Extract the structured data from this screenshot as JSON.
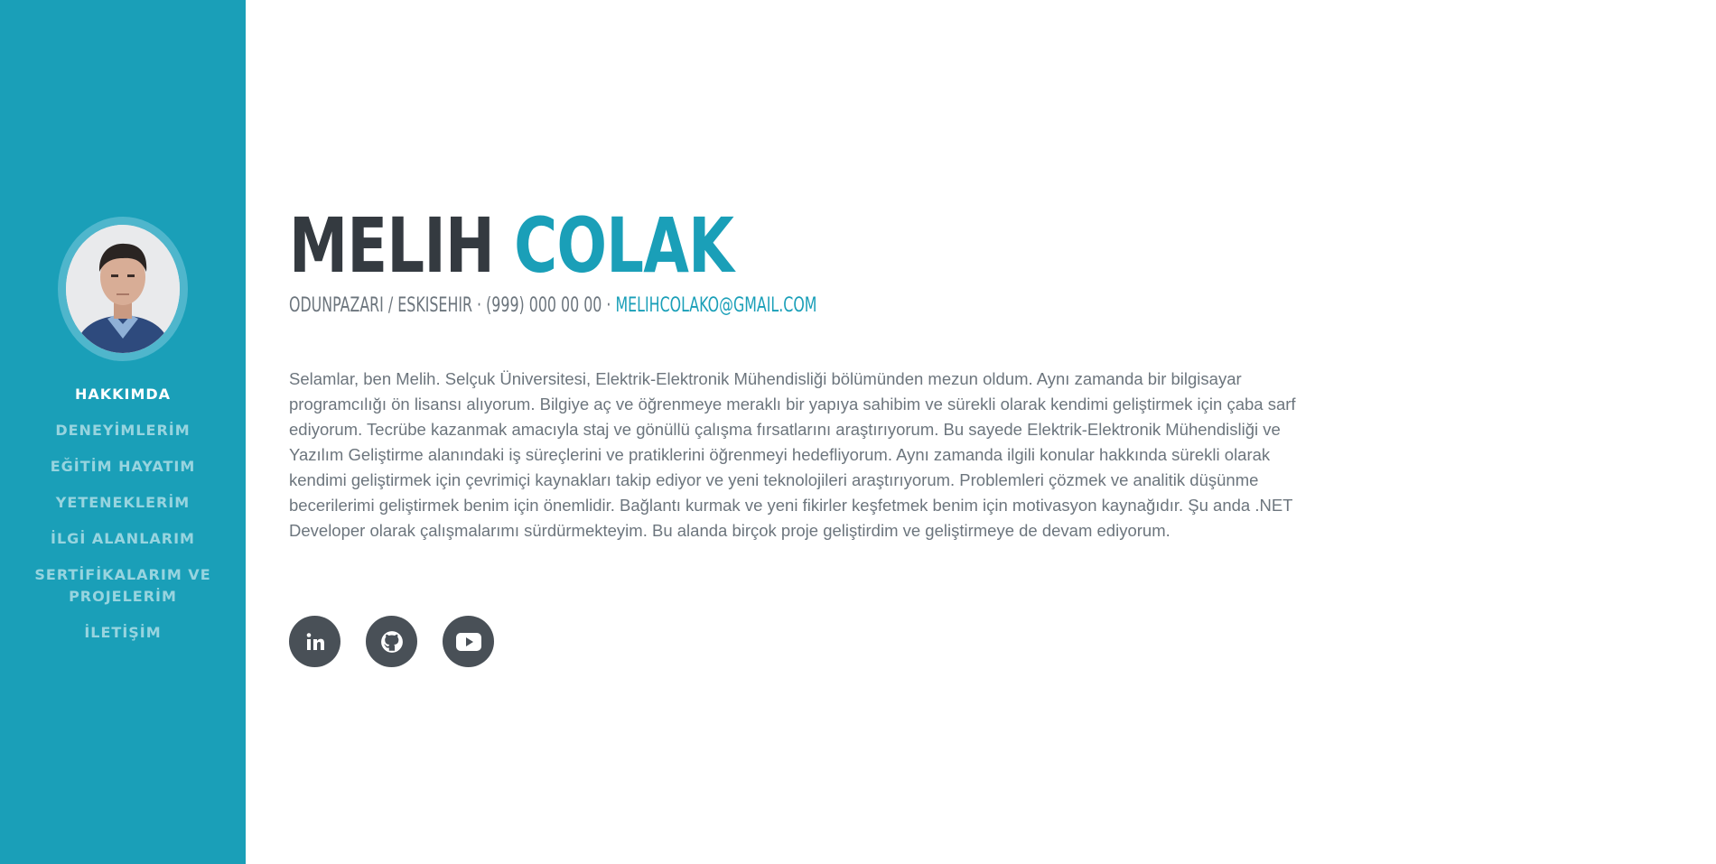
{
  "sidebar": {
    "nav": [
      {
        "label": "HAKKIMDA",
        "active": true
      },
      {
        "label": "DENEYİMLERİM"
      },
      {
        "label": "EĞİTİM HAYATIM"
      },
      {
        "label": "YETENEKLERİM"
      },
      {
        "label": "İLGİ ALANLARIM"
      },
      {
        "label": "SERTİFİKALARIM VE PROJELERİM"
      },
      {
        "label": "İLETİŞİM"
      }
    ]
  },
  "header": {
    "first_name": "MELIH",
    "last_name": "COLAK",
    "location_phone": "ODUNPAZARI / ESKISEHIR · (999) 000 00 00 · ",
    "email": "MELIHCOLAKO@GMAIL.COM"
  },
  "about": {
    "text": "Selamlar, ben Melih. Selçuk Üniversitesi, Elektrik-Elektronik Mühendisliği bölümünden mezun oldum. Aynı zamanda bir bilgisayar programcılığı ön lisansı alıyorum. Bilgiye aç ve öğrenmeye meraklı bir yapıya sahibim ve sürekli olarak kendimi geliştirmek için çaba sarf ediyorum. Tecrübe kazanmak amacıyla staj ve gönüllü çalışma fırsatlarını araştırıyorum. Bu sayede Elektrik-Elektronik Mühendisliği ve Yazılım Geliştirme alanındaki iş süreçlerini ve pratiklerini öğrenmeyi hedefliyorum. Aynı zamanda ilgili konular hakkında sürekli olarak kendimi geliştirmek için çevrimiçi kaynakları takip ediyor ve yeni teknolojileri araştırıyorum. Problemleri çözmek ve analitik düşünme becerilerimi geliştirmek benim için önemlidir. Bağlantı kurmak ve yeni fikirler keşfetmek benim için motivasyon kaynağıdır. Şu anda .NET Developer olarak çalışmalarımı sürdürmekteyim. Bu alanda birçok proje geliştirdim ve geliştirmeye de devam ediyorum."
  },
  "socials": [
    {
      "icon": "linkedin-icon"
    },
    {
      "icon": "github-icon"
    },
    {
      "icon": "youtube-icon"
    }
  ],
  "colors": {
    "primary": "#1a9fb8",
    "dark": "#343a40",
    "muted": "#6c757d",
    "social_bg": "#495057"
  }
}
